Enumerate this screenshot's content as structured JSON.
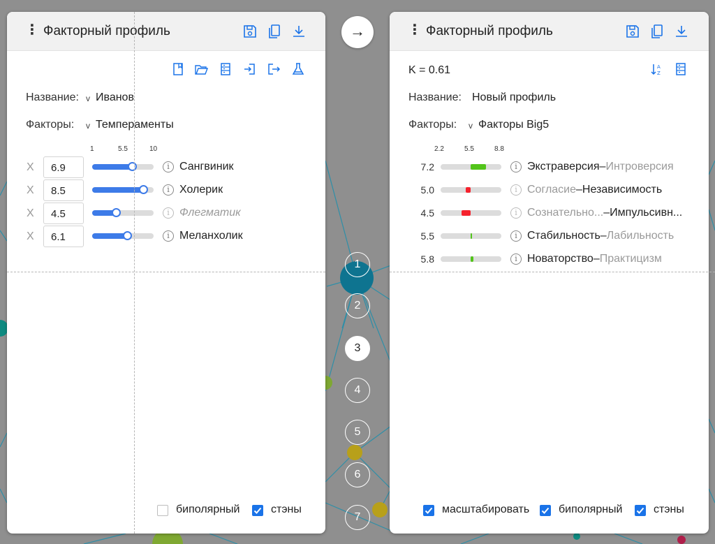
{
  "left_panel": {
    "title": "Факторный профиль",
    "header_icons": [
      "save-icon",
      "copy-icon",
      "download-icon"
    ],
    "toolbar_icons": [
      "book-icon",
      "folder-open-icon",
      "list-icon",
      "import-icon",
      "export-icon",
      "flask-icon"
    ],
    "name_label": "Название:",
    "name_value": "Иванов",
    "factors_label": "Факторы:",
    "factors_value": "Темпераменты",
    "scale": {
      "min": "1",
      "mid": "5.5",
      "max": "10"
    },
    "remove_symbol": "X",
    "factors": [
      {
        "value": "6.9",
        "name": "Сангвиник",
        "active": true
      },
      {
        "value": "8.5",
        "name": "Холерик",
        "active": true
      },
      {
        "value": "4.5",
        "name": "Флегматик",
        "active": false
      },
      {
        "value": "6.1",
        "name": "Меланхолик",
        "active": true
      }
    ],
    "checkboxes": [
      {
        "label": "биполярный",
        "checked": false
      },
      {
        "label": "стэны",
        "checked": true
      }
    ]
  },
  "right_panel": {
    "title": "Факторный профиль",
    "header_icons": [
      "save-icon",
      "copy-icon",
      "download-icon"
    ],
    "toolbar_icons": [
      "sort-az-icon",
      "list-icon"
    ],
    "k_value": "K = 0.61",
    "name_label": "Название:",
    "name_value": "Новый профиль",
    "factors_label": "Факторы:",
    "factors_value": "Факторы Big5",
    "scale": {
      "min": "2.2",
      "mid": "5.5",
      "max": "8.8"
    },
    "factors": [
      {
        "value": "7.2",
        "left": "Экстраверсия",
        "sep": "–",
        "right": "Интроверсия",
        "dominant": "left",
        "color": "#52c41a"
      },
      {
        "value": "5.0",
        "left": "Согласие",
        "sep": "–",
        "right": "Независимость",
        "dominant": "right",
        "color": "#f5222d"
      },
      {
        "value": "4.5",
        "left": "Сознательно...",
        "sep": "–",
        "right": "Импульсивн...",
        "dominant": "right",
        "color": "#f5222d"
      },
      {
        "value": "5.5",
        "left": "Стабильность",
        "sep": "–",
        "right": "Лабильность",
        "dominant": "left",
        "color": "#52c41a"
      },
      {
        "value": "5.8",
        "left": "Новаторство",
        "sep": "–",
        "right": "Практицизм",
        "dominant": "left",
        "color": "#52c41a"
      }
    ],
    "checkboxes": [
      {
        "label": "масштабировать",
        "checked": true
      },
      {
        "label": "биполярный",
        "checked": true
      },
      {
        "label": "стэны",
        "checked": true
      }
    ]
  },
  "center": {
    "arrow": "→",
    "steps": [
      "1",
      "2",
      "3",
      "4",
      "5",
      "6",
      "7"
    ],
    "active_step": "3"
  },
  "colors": {
    "accent": "#1a73e8",
    "slider": "#3d7be8",
    "positive": "#52c41a",
    "negative": "#f5222d"
  }
}
